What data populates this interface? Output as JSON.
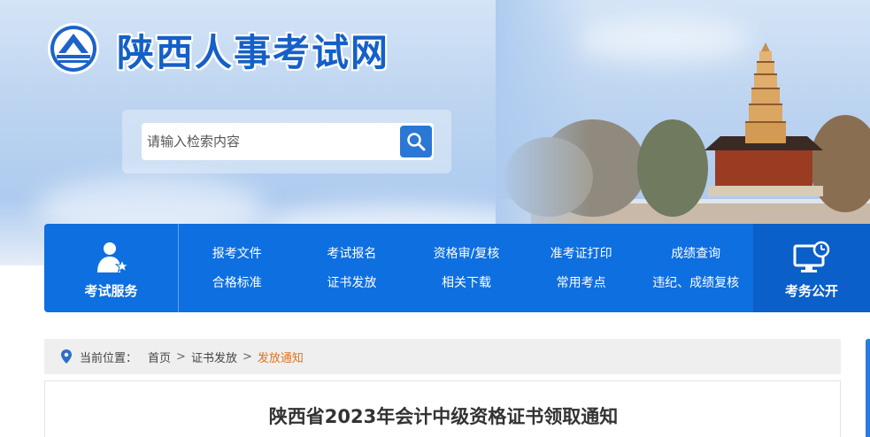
{
  "header": {
    "site_title": "陕西人事考试网",
    "search_placeholder": "请输入检索内容",
    "search_icon": "search-icon",
    "logo_icon": "mountain-logo-icon"
  },
  "nav": {
    "left_block": {
      "label": "考试服务",
      "icon": "exam-service-icon"
    },
    "items": [
      {
        "label": "报考文件"
      },
      {
        "label": "考试报名"
      },
      {
        "label": "资格审/复核"
      },
      {
        "label": "准考证打印"
      },
      {
        "label": "成绩查询"
      },
      {
        "label": "合格标准"
      },
      {
        "label": "证书发放"
      },
      {
        "label": "相关下载"
      },
      {
        "label": "常用考点"
      },
      {
        "label": "违纪、成绩复核"
      }
    ],
    "right_block": {
      "label": "考务公开",
      "icon": "monitor-clock-icon"
    }
  },
  "breadcrumb": {
    "prefix": "当前位置：",
    "items": [
      "首页",
      "证书发放"
    ],
    "current": "发放通知",
    "separator": ">"
  },
  "article": {
    "title": "陕西省2023年会计中级资格证书领取通知"
  },
  "colors": {
    "nav_blue": "#0e6fe0",
    "nav_right_blue": "#0a5fc8",
    "title_blue": "#1560c8",
    "breadcrumb_current": "#e0731d"
  }
}
